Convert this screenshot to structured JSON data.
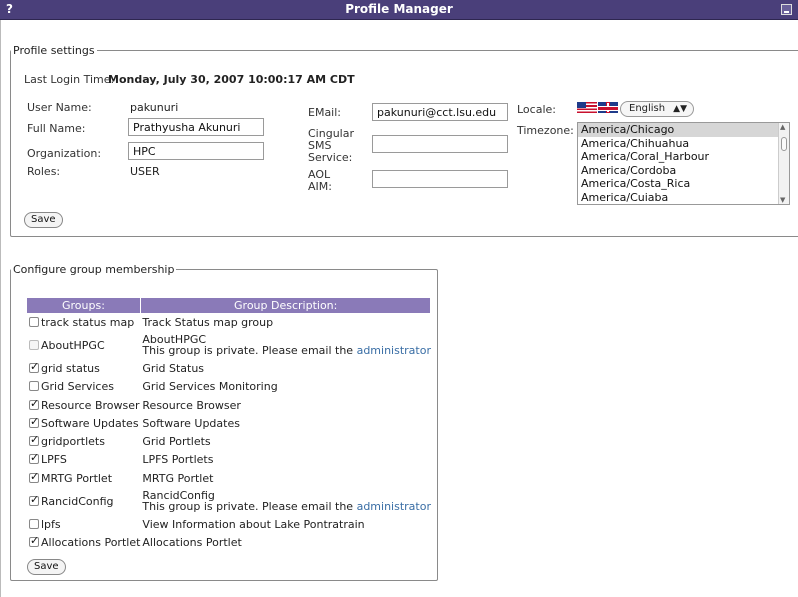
{
  "window": {
    "title": "Profile Manager",
    "help_icon": "?"
  },
  "profile": {
    "legend": "Profile settings",
    "last_login_label": "Last Login Time:",
    "last_login_value": "Monday, July 30, 2007 10:00:17 AM CDT",
    "user_name_label": "User Name:",
    "user_name_value": "pakunuri",
    "full_name_label": "Full Name:",
    "full_name_value": "Prathyusha Akunuri",
    "organization_label": "Organization:",
    "organization_value": "HPC",
    "roles_label": "Roles:",
    "roles_value": "USER",
    "email_label": "EMail:",
    "email_value": "pakunuri@cct.lsu.edu",
    "sms_label_1": "Cingular",
    "sms_label_2": "SMS",
    "sms_label_3": "Service:",
    "sms_value": "",
    "aim_label_1": "AOL",
    "aim_label_2": "AIM:",
    "aim_value": "",
    "locale_label": "Locale:",
    "locale_value": "English",
    "timezone_label": "Timezone:",
    "timezones": [
      "America/Chicago",
      "America/Chihuahua",
      "America/Coral_Harbour",
      "America/Cordoba",
      "America/Costa_Rica",
      "America/Cuiaba"
    ],
    "save_label": "Save"
  },
  "groups": {
    "legend": "Configure group membership",
    "col_groups": "Groups:",
    "col_description": "Group Description:",
    "rows": [
      {
        "name": "track status map",
        "checked": false,
        "disabled": false,
        "desc": "Track Status map group",
        "private_note": ""
      },
      {
        "name": "AboutHPGC",
        "checked": false,
        "disabled": true,
        "desc": "AboutHPGC",
        "private_note": "This group is private. Please email the ",
        "link": "administrator"
      },
      {
        "name": "grid status",
        "checked": true,
        "disabled": false,
        "desc": "Grid Status",
        "private_note": ""
      },
      {
        "name": "Grid Services",
        "checked": false,
        "disabled": false,
        "desc": "Grid Services Monitoring",
        "private_note": ""
      },
      {
        "name": "Resource Browser",
        "checked": true,
        "disabled": false,
        "desc": "Resource Browser",
        "private_note": ""
      },
      {
        "name": "Software Updates",
        "checked": true,
        "disabled": false,
        "desc": "Software Updates",
        "private_note": ""
      },
      {
        "name": "gridportlets",
        "checked": true,
        "disabled": false,
        "desc": "Grid Portlets",
        "private_note": ""
      },
      {
        "name": "LPFS",
        "checked": true,
        "disabled": false,
        "desc": "LPFS Portlets",
        "private_note": ""
      },
      {
        "name": "MRTG Portlet",
        "checked": true,
        "disabled": false,
        "desc": "MRTG Portlet",
        "private_note": ""
      },
      {
        "name": "RancidConfig",
        "checked": true,
        "disabled": false,
        "desc": "RancidConfig",
        "private_note": "This group is private. Please email the ",
        "link": "administrator"
      },
      {
        "name": "lpfs",
        "checked": false,
        "disabled": false,
        "desc": "View Information about Lake Pontratrain",
        "private_note": ""
      },
      {
        "name": "Allocations Portlet",
        "checked": true,
        "disabled": false,
        "desc": "Allocations Portlet",
        "private_note": ""
      }
    ],
    "save_label": "Save"
  },
  "colors": {
    "titlebar": "#4a3f7a",
    "table_header": "#8a7ab8",
    "link": "#3a6ea5"
  }
}
